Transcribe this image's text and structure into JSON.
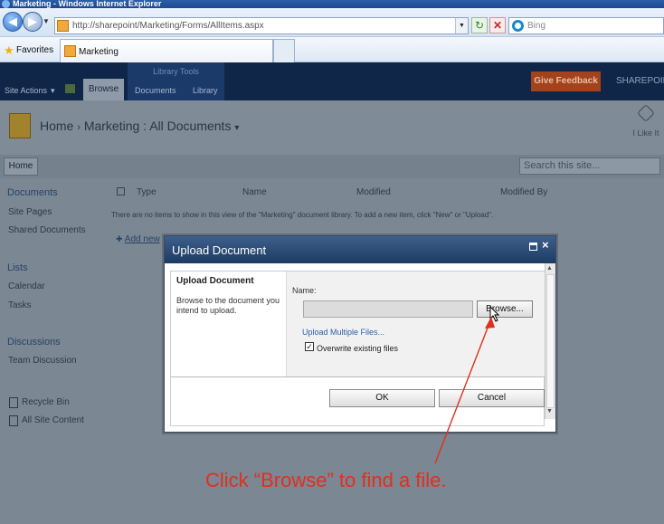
{
  "window": {
    "title": "Marketing - Windows Internet Explorer"
  },
  "browser": {
    "address": "http://sharepoint/Marketing/Forms/AllItems.aspx",
    "search_placeholder": "Bing",
    "favorites_label": "Favorites",
    "tab_title": "Marketing"
  },
  "ribbon": {
    "site_actions": "Site Actions",
    "browse": "Browse",
    "library_tools": "Library Tools",
    "documents": "Documents",
    "library": "Library",
    "give_feedback": "Give Feedback",
    "brand": "SHAREPOIN"
  },
  "header": {
    "breadcrumb_home": "Home",
    "breadcrumb_sep1": "›",
    "breadcrumb_site": "Marketing",
    "breadcrumb_sep2": ":",
    "breadcrumb_page": "All Documents",
    "breadcrumb_drop": "▾",
    "i_like_it": "I Like It"
  },
  "topnav": {
    "home": "Home",
    "search_placeholder": "Search this site..."
  },
  "sidebar": {
    "documents": "Documents",
    "site_pages": "Site Pages",
    "shared_documents": "Shared Documents",
    "lists": "Lists",
    "calendar": "Calendar",
    "tasks": "Tasks",
    "discussions": "Discussions",
    "team_discussion": "Team Discussion",
    "recycle_bin": "Recycle Bin",
    "all_site_content": "All Site Content"
  },
  "list": {
    "columns": [
      "Type",
      "Name",
      "Modified",
      "Modified By"
    ],
    "empty_message": "There are no items to show in this view of the \"Marketing\" document library. To add a new item, click \"New\" or \"Upload\".",
    "add_new": "Add new"
  },
  "dialog": {
    "title": "Upload Document",
    "section_heading": "Upload Document",
    "section_description": "Browse to the document you intend to upload.",
    "name_label": "Name:",
    "browse_button": "Browse...",
    "upload_multiple": "Upload Multiple Files...",
    "overwrite_label": "Overwrite existing files",
    "ok_button": "OK",
    "cancel_button": "Cancel"
  },
  "annotation": {
    "caption": "Click “Browse” to find a file."
  },
  "colors": {
    "ribbon": "#0f2648",
    "dialog_header": "#1d3b63",
    "annotation": "#e0301e",
    "feedback": "#a4421c"
  }
}
